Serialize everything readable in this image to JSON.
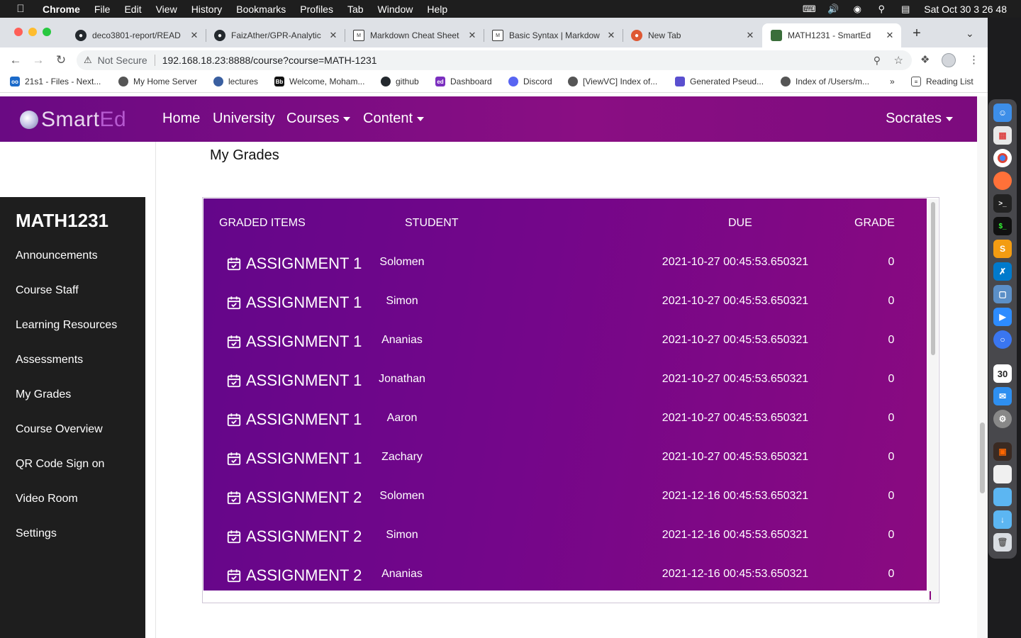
{
  "menubar": {
    "app": "Chrome",
    "items": [
      "File",
      "Edit",
      "View",
      "History",
      "Bookmarks",
      "Profiles",
      "Tab",
      "Window",
      "Help"
    ],
    "clock": "Sat Oct 30  3 26 48"
  },
  "tabs": [
    {
      "title": "deco3801-report/READ",
      "icon": "github-icon"
    },
    {
      "title": "FaizAther/GPR-Analytic",
      "icon": "github-icon"
    },
    {
      "title": "Markdown Cheat Sheet",
      "icon": "markdown-icon"
    },
    {
      "title": "Basic Syntax | Markdow",
      "icon": "markdown-icon"
    },
    {
      "title": "New Tab",
      "icon": "duckduckgo-icon"
    },
    {
      "title": "MATH1231 - SmartEd",
      "icon": "smarted-icon"
    }
  ],
  "omnibox": {
    "security": "Not Secure",
    "url": "192.168.18.23:8888/course?course=MATH-1231"
  },
  "bookmarks": [
    "21s1 - Files - Next...",
    "My Home Server",
    "lectures",
    "Welcome, Moham...",
    "github",
    "Dashboard",
    "Discord",
    "[ViewVC] Index of...",
    "Generated Pseud...",
    "Index of /Users/m..."
  ],
  "reading_list": "Reading List",
  "site": {
    "brand_left": "Smart",
    "brand_right": "Ed",
    "nav": {
      "home": "Home",
      "university": "University",
      "courses": "Courses",
      "content": "Content"
    },
    "user": "Socrates"
  },
  "page_title": "My Grades",
  "sidebar": {
    "course": "MATH1231",
    "items": [
      "Announcements",
      "Course Staff",
      "Learning Resources",
      "Assessments",
      "My Grades",
      "Course Overview",
      "QR Code Sign on",
      "Video Room",
      "Settings"
    ]
  },
  "grades": {
    "headers": {
      "item": "GRADED ITEMS",
      "student": "STUDENT",
      "due": "DUE",
      "grade": "GRADE"
    },
    "rows": [
      {
        "item": "ASSIGNMENT 1",
        "student": "Solomen",
        "due": "2021-10-27 00:45:53.650321",
        "grade": "0"
      },
      {
        "item": "ASSIGNMENT 1",
        "student": "Simon",
        "due": "2021-10-27 00:45:53.650321",
        "grade": "0"
      },
      {
        "item": "ASSIGNMENT 1",
        "student": "Ananias",
        "due": "2021-10-27 00:45:53.650321",
        "grade": "0"
      },
      {
        "item": "ASSIGNMENT 1",
        "student": "Jonathan",
        "due": "2021-10-27 00:45:53.650321",
        "grade": "0"
      },
      {
        "item": "ASSIGNMENT 1",
        "student": "Aaron",
        "due": "2021-10-27 00:45:53.650321",
        "grade": "0"
      },
      {
        "item": "ASSIGNMENT 1",
        "student": "Zachary",
        "due": "2021-10-27 00:45:53.650321",
        "grade": "0"
      },
      {
        "item": "ASSIGNMENT 2",
        "student": "Solomen",
        "due": "2021-12-16 00:45:53.650321",
        "grade": "0"
      },
      {
        "item": "ASSIGNMENT 2",
        "student": "Simon",
        "due": "2021-12-16 00:45:53.650321",
        "grade": "0"
      },
      {
        "item": "ASSIGNMENT 2",
        "student": "Ananias",
        "due": "2021-12-16 00:45:53.650321",
        "grade": "0"
      }
    ]
  },
  "dock_calendar_day": "30",
  "colors": {
    "brand_purple": "#7a0b85",
    "table_purple": "#6e068a",
    "sidebar": "#1e1e1e"
  }
}
